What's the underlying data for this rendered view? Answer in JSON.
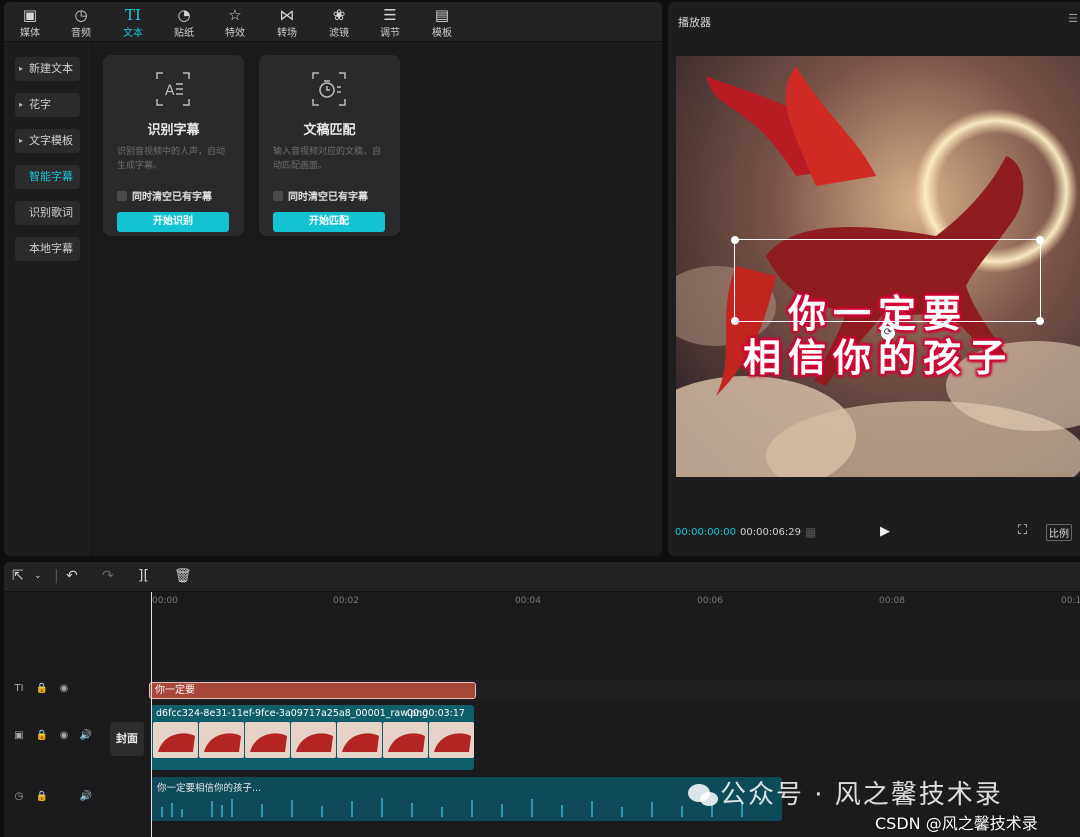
{
  "toolbar_tabs": [
    {
      "label": "媒体",
      "icon": "media-icon"
    },
    {
      "label": "音频",
      "icon": "audio-icon"
    },
    {
      "label": "文本",
      "icon": "text-icon",
      "active": true
    },
    {
      "label": "贴纸",
      "icon": "sticker-icon"
    },
    {
      "label": "特效",
      "icon": "effects-icon"
    },
    {
      "label": "转场",
      "icon": "transition-icon"
    },
    {
      "label": "滤镜",
      "icon": "filter-icon"
    },
    {
      "label": "调节",
      "icon": "adjust-icon"
    },
    {
      "label": "模板",
      "icon": "template-icon"
    }
  ],
  "sidebar": {
    "items": [
      {
        "label": "新建文本",
        "arrow": true
      },
      {
        "label": "花字",
        "arrow": true
      },
      {
        "label": "文字模板",
        "arrow": true
      },
      {
        "label": "智能字幕",
        "active": true
      },
      {
        "label": "识别歌词"
      },
      {
        "label": "本地字幕"
      }
    ]
  },
  "cards": [
    {
      "title": "识别字幕",
      "desc": "识别音视频中的人声，自动生成字幕。",
      "checkbox": "同时清空已有字幕",
      "button": "开始识别"
    },
    {
      "title": "文稿匹配",
      "desc": "输入音视频对应的文稿，自动匹配画面。",
      "checkbox": "同时清空已有字幕",
      "button": "开始匹配"
    }
  ],
  "player": {
    "title": "播放器",
    "subtitle_line1": "你一定要",
    "subtitle_line2": "相信你的孩子",
    "current_time": "00:00:00:00",
    "duration": "00:00:06:29",
    "ratio_label": "比例"
  },
  "timeline": {
    "ruler": [
      "00:00",
      "00:02",
      "00:04",
      "00:06",
      "00:08",
      "00:1"
    ],
    "text_clip": "你一定要",
    "video_clip_name": "d6fcc324-8e31-11ef-9fce-3a09717a25a8_00001_raw.png",
    "video_clip_duration": "00:00:03:17",
    "cover_label": "封面",
    "audio_clip_name": "你一定要相信你的孩子..."
  },
  "watermark": {
    "text": "公众号 · 风之馨技术录",
    "csdn": "CSDN @风之馨技术录"
  },
  "colors": {
    "accent": "#18c7d6",
    "button": "#14c3d3",
    "text_clip": "#a6473a",
    "video_clip": "#0f5f6b",
    "audio_clip": "#0e4a5a"
  }
}
